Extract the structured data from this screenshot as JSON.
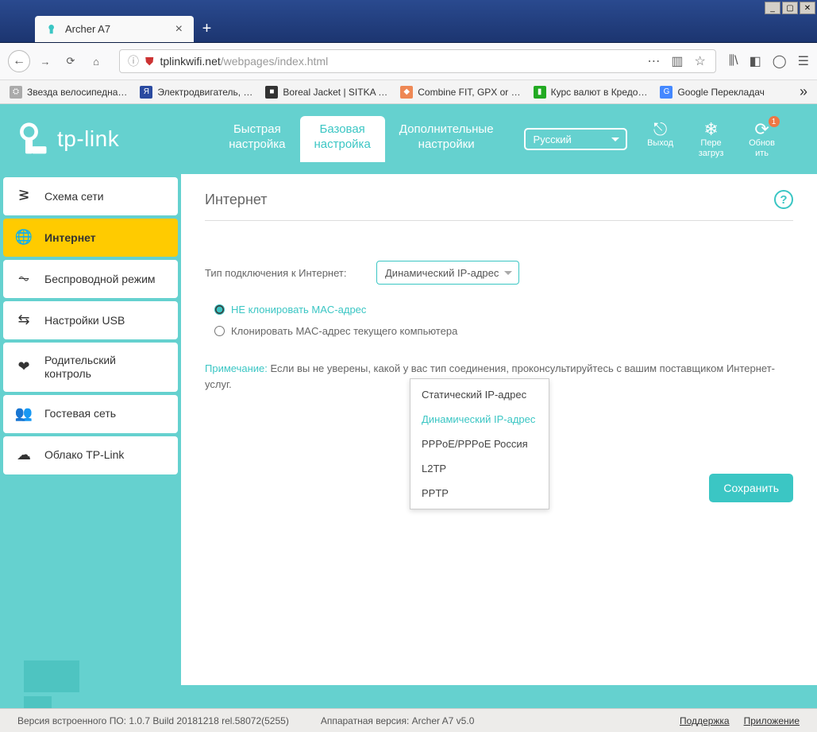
{
  "window": {
    "controls": {
      "min": "_",
      "max": "▢",
      "close": "✕"
    },
    "tab_title": "Archer A7",
    "new_tab": "+"
  },
  "toolbar": {
    "url_host": "tplinkwifi.net",
    "url_path": "/webpages/index.html"
  },
  "bookmarks": {
    "items": [
      {
        "label": "Звезда велосипедна…",
        "color": "#ccc",
        "glyph": "⚙"
      },
      {
        "label": "Электродвигатель, …",
        "color": "#2a4aa0",
        "glyph": "Я"
      },
      {
        "label": "Boreal Jacket | SITKA …",
        "color": "#333",
        "glyph": "■"
      },
      {
        "label": "Combine FIT, GPX or …",
        "color": "#e85",
        "glyph": "◆"
      },
      {
        "label": "Курс валют в Кредо…",
        "color": "#2a2",
        "glyph": "∥"
      },
      {
        "label": "Google Перекладач",
        "color": "#48f",
        "glyph": "G"
      }
    ],
    "more": "»"
  },
  "header": {
    "logo_text": "tp-link",
    "tabs": [
      {
        "label": "Быстрая\nнастройка"
      },
      {
        "label": "Базовая\nнастройка"
      },
      {
        "label": "Дополнительные\nнастройки"
      }
    ],
    "active_tab": 1,
    "language": "Русский",
    "actions": {
      "logout": "Выход",
      "reboot": "Пере\nзагруз",
      "update": "Обнов\nить",
      "update_badge": "1"
    }
  },
  "sidebar": {
    "items": [
      {
        "icon": "network-map-icon",
        "glyph": "⊓",
        "label": "Схема сети"
      },
      {
        "icon": "globe-icon",
        "glyph": "⊕",
        "label": "Интернет"
      },
      {
        "icon": "wifi-icon",
        "glyph": "⟑",
        "label": "Беспроводной режим"
      },
      {
        "icon": "usb-icon",
        "glyph": "⇄",
        "label": "Настройки USB"
      },
      {
        "icon": "heart-icon",
        "glyph": "❤",
        "label": "Родительский контроль"
      },
      {
        "icon": "users-icon",
        "glyph": "👥",
        "label": "Гостевая сеть"
      },
      {
        "icon": "cloud-icon",
        "glyph": "☁",
        "label": "Облако TP-Link"
      }
    ],
    "active": 1
  },
  "content": {
    "title": "Интернет",
    "help": "?",
    "conn_label": "Тип подключения к Интернет:",
    "conn_value": "Динамический IP-адрес",
    "options": [
      "Статический IP-адрес",
      "Динамический IP-адрес",
      "PPPoE/PPPoE Россия",
      "L2TP",
      "PPTP"
    ],
    "selected_option": 1,
    "mac_options": [
      "НЕ клонировать MAC-адрес",
      "Клонировать MAC-адрес текущего компьютера"
    ],
    "mac_selected": 0,
    "note_label": "Примечание:",
    "note_text": "Если вы не уверены, какой у вас тип соединения, проконсультируйтесь с вашим поставщиком Интернет-услуг.",
    "save": "Сохранить"
  },
  "footer": {
    "fw": "Версия встроенного ПО: 1.0.7 Build 20181218 rel.58072(5255)",
    "hw": "Аппаратная версия: Archer A7 v5.0",
    "support": "Поддержка",
    "app": "Приложение"
  }
}
